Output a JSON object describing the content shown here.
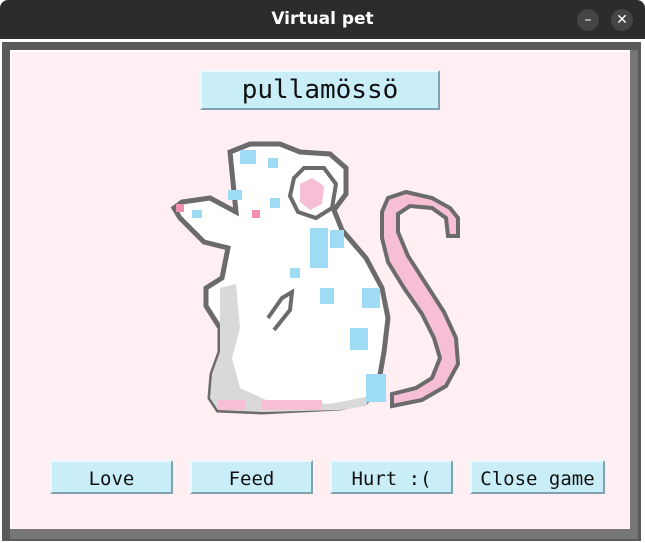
{
  "window": {
    "title": "Virtual pet",
    "minimize_glyph": "–",
    "close_glyph": "✕"
  },
  "pet": {
    "name": "pullamössö",
    "image": "pixel-rat-icon"
  },
  "buttons": {
    "love": "Love",
    "feed": "Feed",
    "hurt": "Hurt :(",
    "close": "Close game"
  },
  "colors": {
    "panel_bg": "#ffeef2",
    "button_bg": "#c9eef7",
    "titlebar_bg": "#2c2c2c"
  }
}
